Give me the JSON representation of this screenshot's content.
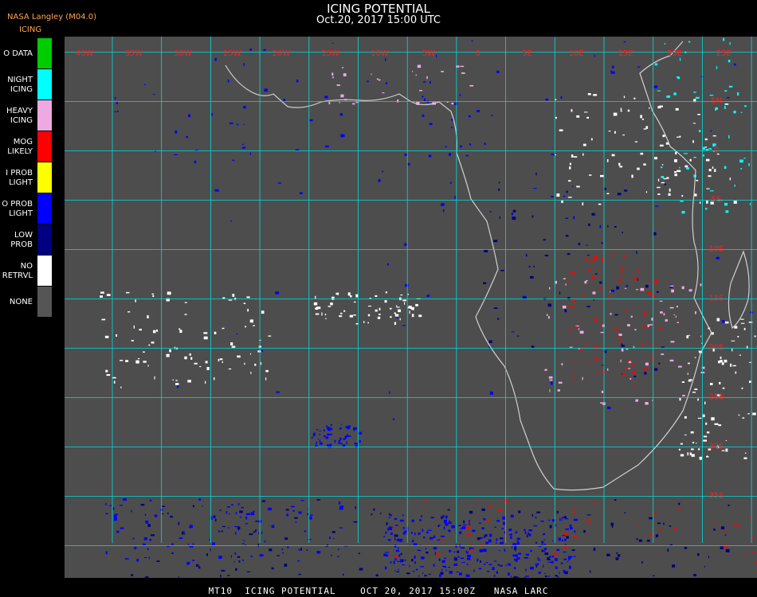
{
  "header": {
    "title": "ICING POTENTIAL",
    "subtitle": "Oct.20, 2017 15:00 UTC",
    "org": "NASA Langley (M04.0)",
    "product": "ICING"
  },
  "legend": [
    {
      "label": "O DATA",
      "color": "#00cc00"
    },
    {
      "label": "NIGHT\nICING",
      "color": "#00ffff"
    },
    {
      "label": "HEAVY\nICING",
      "color": "#f0a8e0"
    },
    {
      "label": "MOG\nLIKELY",
      "color": "#ff0000"
    },
    {
      "label": "I PROB\nLIGHT",
      "color": "#ffff00"
    },
    {
      "label": "O PROB\nLIGHT",
      "color": "#0000ff"
    },
    {
      "label": "LOW\nPROB",
      "color": "#000080"
    },
    {
      "label": "NO\nRETRVL",
      "color": "#ffffff"
    },
    {
      "label": "NONE",
      "color": "#555555"
    }
  ],
  "map": {
    "background_color": "#4d4d4d",
    "grid_color": "#00dddd",
    "coast_color": "#cfcfcf",
    "label_color": "#ff2020",
    "lon_labels": [
      "40W",
      "35W",
      "30W",
      "25W",
      "20W",
      "15W",
      "10W",
      "5W",
      "0",
      "5E",
      "10E",
      "15E",
      "20E",
      "25E",
      "30E"
    ],
    "lat_labels": [
      "5N",
      "0",
      "5S",
      "10S",
      "15S",
      "20S",
      "25S",
      "30S",
      "35S"
    ]
  },
  "footer": "MT10  ICING POTENTIAL    OCT 20, 2017 15:00Z   NASA LARC"
}
